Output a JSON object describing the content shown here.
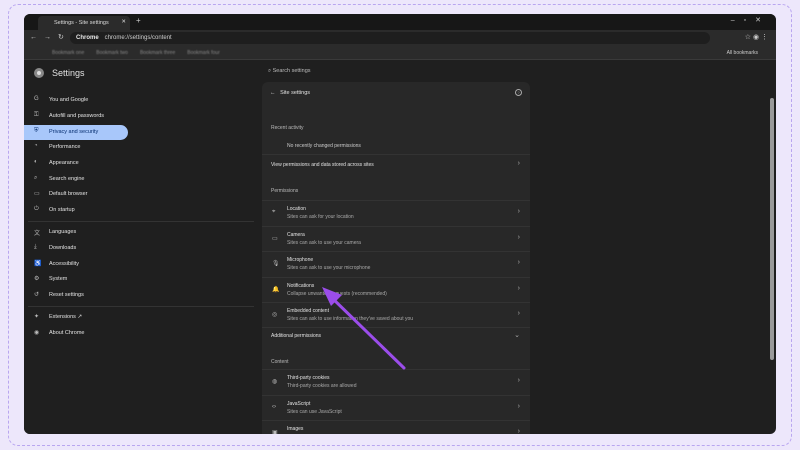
{
  "browser": {
    "tab_title": "Settings - Site settings",
    "url_chip": "Chrome",
    "url": "chrome://settings/content",
    "bookmarks": [
      "Bookmark one",
      "Bookmark two",
      "Bookmark three",
      "Bookmark four"
    ],
    "all_bookmarks": "All bookmarks"
  },
  "sidebar": {
    "title": "Settings",
    "search_placeholder": "Search settings",
    "items": [
      {
        "label": "You and Google",
        "icon": "G"
      },
      {
        "label": "Autofill and passwords",
        "icon": "⚿"
      },
      {
        "label": "Privacy and security",
        "icon": "⛨"
      },
      {
        "label": "Performance",
        "icon": "◔"
      },
      {
        "label": "Appearance",
        "icon": "◐"
      },
      {
        "label": "Search engine",
        "icon": "⌕"
      },
      {
        "label": "Default browser",
        "icon": "▭"
      },
      {
        "label": "On startup",
        "icon": "⏻"
      },
      {
        "label": "Languages",
        "icon": "文"
      },
      {
        "label": "Downloads",
        "icon": "⤓"
      },
      {
        "label": "Accessibility",
        "icon": "♿"
      },
      {
        "label": "System",
        "icon": "⚙"
      },
      {
        "label": "Reset settings",
        "icon": "↺"
      },
      {
        "label": "Extensions",
        "icon": "✦"
      },
      {
        "label": "About Chrome",
        "icon": "◉"
      }
    ]
  },
  "main": {
    "title": "Site settings",
    "recent_heading": "Recent activity",
    "recent_empty": "No recently changed permissions",
    "view_all": "View permissions and data stored across sites",
    "permissions_heading": "Permissions",
    "permissions": [
      {
        "title": "Location",
        "sub": "Sites can ask for your location",
        "icon": "⌖"
      },
      {
        "title": "Camera",
        "sub": "Sites can ask to use your camera",
        "icon": "▭"
      },
      {
        "title": "Microphone",
        "sub": "Sites can ask to use your microphone",
        "icon": "🎙"
      },
      {
        "title": "Notifications",
        "sub": "Collapse unwanted requests (recommended)",
        "icon": "🔔"
      },
      {
        "title": "Embedded content",
        "sub": "Sites can ask to use information they've saved about you",
        "icon": "◎"
      }
    ],
    "additional": "Additional permissions",
    "content_heading": "Content",
    "content": [
      {
        "title": "Third-party cookies",
        "sub": "Third-party cookies are allowed",
        "icon": "◍"
      },
      {
        "title": "JavaScript",
        "sub": "Sites can use JavaScript",
        "icon": "‹›"
      },
      {
        "title": "Images",
        "sub": "",
        "icon": "▣"
      }
    ]
  },
  "annotation": {
    "arrow_color": "#9b4dea"
  }
}
